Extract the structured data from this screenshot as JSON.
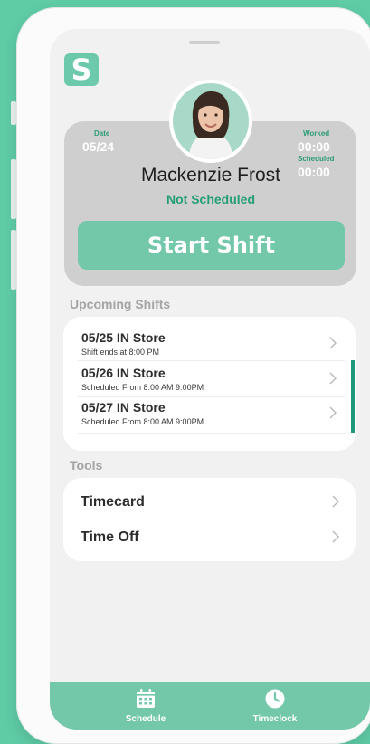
{
  "app": {
    "logo_letter": "S"
  },
  "profile": {
    "date_label": "Date",
    "date_value": "05/24",
    "worked_label": "Worked",
    "worked_value": "00:00",
    "scheduled_label": "Scheduled",
    "scheduled_value": "00:00",
    "name": "Mackenzie Frost",
    "status": "Not Scheduled",
    "start_button": "Start Shift"
  },
  "upcoming": {
    "title": "Upcoming Shifts",
    "shifts": [
      {
        "title": "05/25  IN Store",
        "subtitle": "Shift ends at 8:00 PM"
      },
      {
        "title": "05/26  IN Store",
        "subtitle": "Scheduled From 8:00 AM   9:00PM"
      },
      {
        "title": "05/27  IN Store",
        "subtitle": "Scheduled From 8:00 AM   9:00PM"
      }
    ]
  },
  "tools": {
    "title": "Tools",
    "items": [
      {
        "label": "Timecard"
      },
      {
        "label": "Time Off"
      }
    ]
  },
  "tabs": [
    {
      "label": "Schedule",
      "icon": "calendar-icon"
    },
    {
      "label": "Timeclock",
      "icon": "clock-icon"
    }
  ],
  "colors": {
    "background": "#5fcca6",
    "accent": "#73c8aa",
    "status_green": "#249e77"
  }
}
